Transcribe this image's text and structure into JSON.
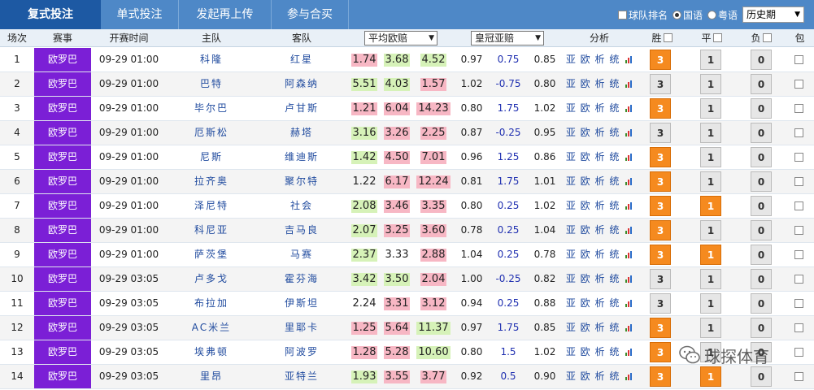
{
  "tabs": [
    {
      "label": "复式投注",
      "active": true
    },
    {
      "label": "单式投注",
      "active": false
    },
    {
      "label": "发起再上传",
      "active": false
    },
    {
      "label": "参与合买",
      "active": false
    }
  ],
  "controls": {
    "team_rank_label": "球队排名",
    "lang_mandarin": "国语",
    "lang_cantonese": "粤语",
    "history_select": "历史期"
  },
  "headers": {
    "no": "场次",
    "league": "赛事",
    "time": "开赛时间",
    "home": "主队",
    "away": "客队",
    "avg_odds": "平均欧赔",
    "asian": "皇冠亚赔",
    "analysis": "分析",
    "win": "胜",
    "draw": "平",
    "lose": "负",
    "pack": "包"
  },
  "colors": {
    "tabbar": "#4e88c7",
    "tab_active": "#1d59a3",
    "league_bg": "#7b1fd6",
    "odds_pink": "#f7b7c4",
    "odds_green": "#d6f2b8",
    "pick_on": "#f58a1f"
  },
  "analysis_labels": {
    "asia": "亚",
    "euro": "欧",
    "analysis": "析",
    "stats": "统"
  },
  "rows": [
    {
      "no": "1",
      "league": "欧罗巴",
      "time": "09-29 01:00",
      "home": "科隆",
      "away": "红星",
      "o1": "1.74",
      "o2": "3.68",
      "o3": "4.52",
      "h1": "0.97",
      "line": "0.75",
      "h2": "0.85",
      "c1": "pink",
      "c2": "green",
      "c3": "green",
      "win": "3",
      "draw": "1",
      "lose": "0",
      "won": true,
      "drawn": false
    },
    {
      "no": "2",
      "league": "欧罗巴",
      "time": "09-29 01:00",
      "home": "巴特",
      "away": "阿森纳",
      "o1": "5.51",
      "o2": "4.03",
      "o3": "1.57",
      "h1": "1.02",
      "line": "-0.75",
      "h2": "0.80",
      "c1": "green",
      "c2": "green",
      "c3": "pink",
      "win": "3",
      "draw": "1",
      "lose": "0",
      "won": false,
      "drawn": false
    },
    {
      "no": "3",
      "league": "欧罗巴",
      "time": "09-29 01:00",
      "home": "毕尔巴",
      "away": "卢甘斯",
      "o1": "1.21",
      "o2": "6.04",
      "o3": "14.23",
      "h1": "0.80",
      "line": "1.75",
      "h2": "1.02",
      "c1": "pink",
      "c2": "pink",
      "c3": "pink",
      "win": "3",
      "draw": "1",
      "lose": "0",
      "won": true,
      "drawn": false
    },
    {
      "no": "4",
      "league": "欧罗巴",
      "time": "09-29 01:00",
      "home": "厄斯松",
      "away": "赫塔",
      "o1": "3.16",
      "o2": "3.26",
      "o3": "2.25",
      "h1": "0.87",
      "line": "-0.25",
      "h2": "0.95",
      "c1": "green",
      "c2": "pink",
      "c3": "pink",
      "win": "3",
      "draw": "1",
      "lose": "0",
      "won": false,
      "drawn": false
    },
    {
      "no": "5",
      "league": "欧罗巴",
      "time": "09-29 01:00",
      "home": "尼斯",
      "away": "维迪斯",
      "o1": "1.42",
      "o2": "4.50",
      "o3": "7.01",
      "h1": "0.96",
      "line": "1.25",
      "h2": "0.86",
      "c1": "green",
      "c2": "pink",
      "c3": "pink",
      "win": "3",
      "draw": "1",
      "lose": "0",
      "won": true,
      "drawn": false
    },
    {
      "no": "6",
      "league": "欧罗巴",
      "time": "09-29 01:00",
      "home": "拉齐奥",
      "away": "聚尔特",
      "o1": "1.22",
      "o2": "6.17",
      "o3": "12.24",
      "h1": "0.81",
      "line": "1.75",
      "h2": "1.01",
      "c1": "none",
      "c2": "pink",
      "c3": "pink",
      "win": "3",
      "draw": "1",
      "lose": "0",
      "won": true,
      "drawn": false
    },
    {
      "no": "7",
      "league": "欧罗巴",
      "time": "09-29 01:00",
      "home": "泽尼特",
      "away": "社会",
      "o1": "2.08",
      "o2": "3.46",
      "o3": "3.35",
      "h1": "0.80",
      "line": "0.25",
      "h2": "1.02",
      "c1": "green",
      "c2": "pink",
      "c3": "pink",
      "win": "3",
      "draw": "1",
      "lose": "0",
      "won": true,
      "drawn": true
    },
    {
      "no": "8",
      "league": "欧罗巴",
      "time": "09-29 01:00",
      "home": "科尼亚",
      "away": "吉马良",
      "o1": "2.07",
      "o2": "3.25",
      "o3": "3.60",
      "h1": "0.78",
      "line": "0.25",
      "h2": "1.04",
      "c1": "green",
      "c2": "pink",
      "c3": "pink",
      "win": "3",
      "draw": "1",
      "lose": "0",
      "won": true,
      "drawn": false
    },
    {
      "no": "9",
      "league": "欧罗巴",
      "time": "09-29 01:00",
      "home": "萨茨堡",
      "away": "马赛",
      "o1": "2.37",
      "o2": "3.33",
      "o3": "2.88",
      "h1": "1.04",
      "line": "0.25",
      "h2": "0.78",
      "c1": "green",
      "c2": "none",
      "c3": "pink",
      "win": "3",
      "draw": "1",
      "lose": "0",
      "won": true,
      "drawn": true
    },
    {
      "no": "10",
      "league": "欧罗巴",
      "time": "09-29 03:05",
      "home": "卢多戈",
      "away": "霍芬海",
      "o1": "3.42",
      "o2": "3.50",
      "o3": "2.04",
      "h1": "1.00",
      "line": "-0.25",
      "h2": "0.82",
      "c1": "green",
      "c2": "green",
      "c3": "pink",
      "win": "3",
      "draw": "1",
      "lose": "0",
      "won": false,
      "drawn": false
    },
    {
      "no": "11",
      "league": "欧罗巴",
      "time": "09-29 03:05",
      "home": "布拉加",
      "away": "伊斯坦",
      "o1": "2.24",
      "o2": "3.31",
      "o3": "3.12",
      "h1": "0.94",
      "line": "0.25",
      "h2": "0.88",
      "c1": "none",
      "c2": "pink",
      "c3": "pink",
      "win": "3",
      "draw": "1",
      "lose": "0",
      "won": false,
      "drawn": false
    },
    {
      "no": "12",
      "league": "欧罗巴",
      "time": "09-29 03:05",
      "home": "AC米兰",
      "away": "里耶卡",
      "o1": "1.25",
      "o2": "5.64",
      "o3": "11.37",
      "h1": "0.97",
      "line": "1.75",
      "h2": "0.85",
      "c1": "pink",
      "c2": "pink",
      "c3": "green",
      "win": "3",
      "draw": "1",
      "lose": "0",
      "won": true,
      "drawn": false
    },
    {
      "no": "13",
      "league": "欧罗巴",
      "time": "09-29 03:05",
      "home": "埃弗顿",
      "away": "阿波罗",
      "o1": "1.28",
      "o2": "5.28",
      "o3": "10.60",
      "h1": "0.80",
      "line": "1.5",
      "h2": "1.02",
      "c1": "pink",
      "c2": "pink",
      "c3": "green",
      "win": "3",
      "draw": "1",
      "lose": "0",
      "won": true,
      "drawn": false
    },
    {
      "no": "14",
      "league": "欧罗巴",
      "time": "09-29 03:05",
      "home": "里昂",
      "away": "亚特兰",
      "o1": "1.93",
      "o2": "3.55",
      "o3": "3.77",
      "h1": "0.92",
      "line": "0.5",
      "h2": "0.90",
      "c1": "green",
      "c2": "pink",
      "c3": "pink",
      "win": "3",
      "draw": "1",
      "lose": "0",
      "won": true,
      "drawn": true
    }
  ],
  "watermark": {
    "text": "球探体育"
  }
}
